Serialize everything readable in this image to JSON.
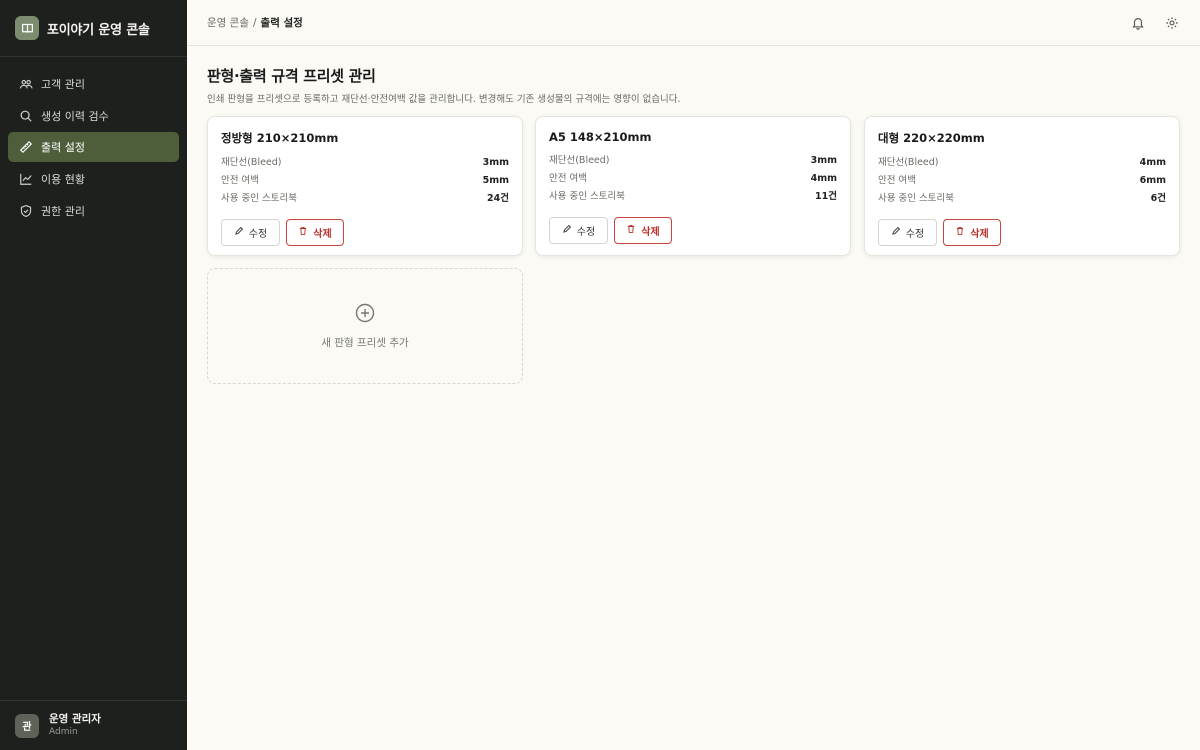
{
  "app": {
    "title": "포이야기 운영 콘솔"
  },
  "sidebar": {
    "items": [
      {
        "label": "고객 관리",
        "icon": "users-icon"
      },
      {
        "label": "생성 이력 검수",
        "icon": "search-icon"
      },
      {
        "label": "출력 설정",
        "icon": "ruler-icon",
        "active": true
      },
      {
        "label": "이용 현황",
        "icon": "chart-line-icon"
      },
      {
        "label": "권한 관리",
        "icon": "shield-icon"
      }
    ],
    "user": {
      "avatar": "관",
      "name": "운영 관리자",
      "role": "Admin"
    }
  },
  "breadcrumb": {
    "parent": "운영 콘솔",
    "sep": "/",
    "current": "출력 설정"
  },
  "page": {
    "title": "판형·출력 규격 프리셋 관리",
    "description": "인쇄 판형을 프리셋으로 등록하고 재단선·안전여백 값을 관리합니다. 변경해도 기존 생성물의 규격에는 영향이 없습니다."
  },
  "labels": {
    "bleed": "재단선(Bleed)",
    "safe_margin": "안전 여백",
    "in_use": "사용 중인 스토리북",
    "edit": "수정",
    "delete": "삭제",
    "add_preset": "새 판형 프리셋 추가"
  },
  "presets": [
    {
      "name": "정방형 210×210mm",
      "bleed": "3mm",
      "safe_margin": "5mm",
      "in_use": "24건"
    },
    {
      "name": "A5 148×210mm",
      "bleed": "3mm",
      "safe_margin": "4mm",
      "in_use": "11건"
    },
    {
      "name": "대형 220×220mm",
      "bleed": "4mm",
      "safe_margin": "6mm",
      "in_use": "6건"
    }
  ],
  "colors": {
    "accent": "#4e5e3a",
    "danger": "#c8443c",
    "sidebar_bg": "#1d201c"
  }
}
